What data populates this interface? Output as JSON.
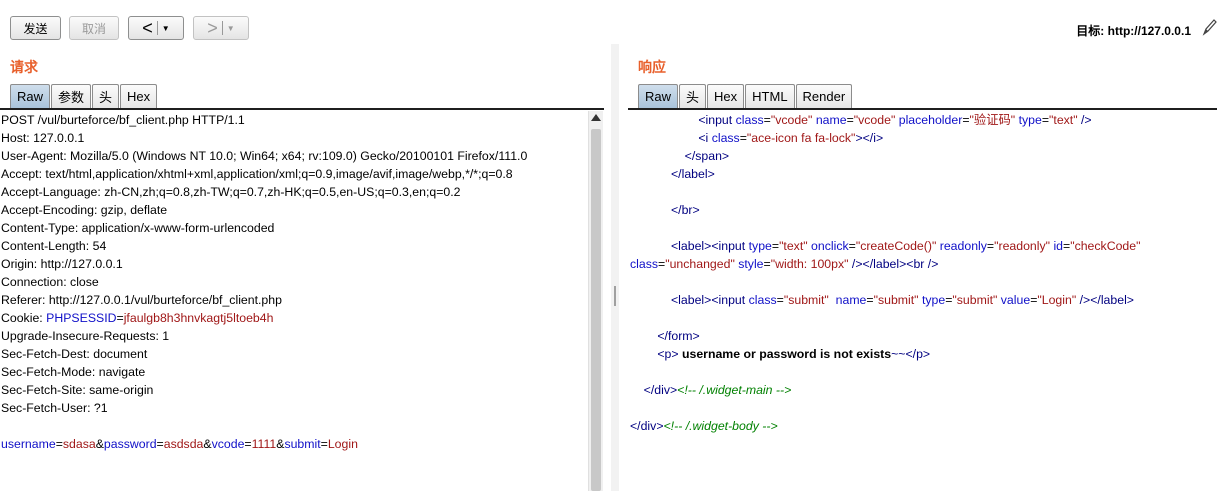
{
  "toolbar": {
    "send_label": "发送",
    "cancel_label": "取消",
    "back_arrow": "<",
    "forward_arrow": ">",
    "dropdown_glyph": "▼",
    "target_label": "目标: http://127.0.0.1"
  },
  "request": {
    "title": "请求",
    "tabs": [
      "Raw",
      "参数",
      "头",
      "Hex"
    ],
    "active_tab": "Raw",
    "lines": [
      "POST /vul/burteforce/bf_client.php HTTP/1.1",
      "Host: 127.0.0.1",
      "User-Agent: Mozilla/5.0 (Windows NT 10.0; Win64; x64; rv:109.0) Gecko/20100101 Firefox/111.0",
      "Accept: text/html,application/xhtml+xml,application/xml;q=0.9,image/avif,image/webp,*/*;q=0.8",
      "Accept-Language: zh-CN,zh;q=0.8,zh-TW;q=0.7,zh-HK;q=0.5,en-US;q=0.3,en;q=0.2",
      "Accept-Encoding: gzip, deflate",
      "Content-Type: application/x-www-form-urlencoded",
      "Content-Length: 54",
      "Origin: http://127.0.0.1",
      "Connection: close",
      "Referer: http://127.0.0.1/vul/burteforce/bf_client.php"
    ],
    "cookie": {
      "prefix": "Cookie: ",
      "name": "PHPSESSID",
      "eq": "=",
      "value": "jfaulgb8h3hnvkagtj5ltoeb4h"
    },
    "lines_after": [
      "Upgrade-Insecure-Requests: 1",
      "Sec-Fetch-Dest: document",
      "Sec-Fetch-Mode: navigate",
      "Sec-Fetch-Site: same-origin",
      "Sec-Fetch-User: ?1"
    ],
    "body_params": [
      {
        "name": "username",
        "value": "sdasa"
      },
      {
        "name": "password",
        "value": "asdsda"
      },
      {
        "name": "vcode",
        "value": "1111"
      },
      {
        "name": "submit",
        "value": "Login"
      }
    ]
  },
  "response": {
    "title": "响应",
    "tabs": [
      "Raw",
      "头",
      "Hex",
      "HTML",
      "Render"
    ],
    "active_tab": "Raw",
    "bold_text": "username or password is not exists",
    "tilde_text": "~~",
    "comment_main": "<!-- /.widget-main -->",
    "comment_body": "<!-- /.widget-body -->",
    "placeholder_value": "验证码"
  },
  "colors": {
    "section_title": "#e8602c",
    "param_name": "#1010c8",
    "param_value": "#a01818",
    "html_tag": "#000080",
    "comment": "#008000",
    "active_tab": "#a9c3da"
  }
}
